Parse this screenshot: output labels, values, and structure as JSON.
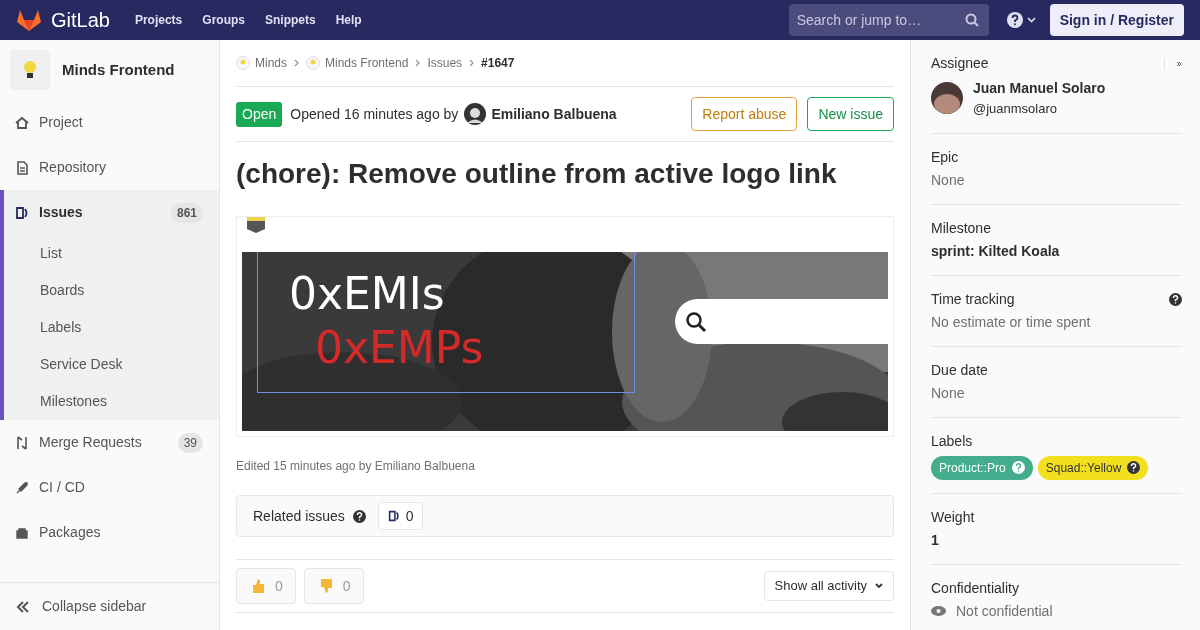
{
  "header": {
    "brand": "GitLab",
    "nav": [
      "Projects",
      "Groups",
      "Snippets",
      "Help"
    ],
    "search": {
      "placeholder": "Search or jump to…"
    },
    "signin": "Sign in / Register"
  },
  "sidebar": {
    "project": "Minds Frontend",
    "items": [
      {
        "label": "Project",
        "selected": false
      },
      {
        "label": "Repository",
        "selected": false
      },
      {
        "label": "Issues",
        "selected": true,
        "count": "861",
        "children": [
          {
            "label": "List"
          },
          {
            "label": "Boards"
          },
          {
            "label": "Labels"
          },
          {
            "label": "Service Desk"
          },
          {
            "label": "Milestones"
          }
        ]
      },
      {
        "label": "Merge Requests",
        "selected": false,
        "count": "39"
      },
      {
        "label": "CI / CD",
        "selected": false
      },
      {
        "label": "Packages",
        "selected": false
      }
    ],
    "collapse": "Collapse sidebar"
  },
  "breadcrumbs": [
    {
      "label": "Minds",
      "avatar": true
    },
    {
      "label": "Minds Frontend",
      "avatar": true
    },
    {
      "label": "Issues",
      "avatar": false
    },
    {
      "label": "#1647",
      "avatar": false
    }
  ],
  "issue": {
    "status": "Open",
    "opened": "Opened 16 minutes ago by",
    "author": "Emiliano Balbuena",
    "actions": [
      {
        "label": "Report abuse",
        "kind": "warning"
      },
      {
        "label": "New issue",
        "kind": "success"
      }
    ],
    "title": "(chore): Remove outline from active logo link",
    "attachment": {
      "kind": "picture",
      "text_white": "0xEMIs",
      "text_red": "0xEMPs"
    },
    "edited": "Edited 15 minutes ago by Emiliano Balbuena",
    "related": {
      "label": "Related issues",
      "count": "0"
    },
    "reactions": [
      {
        "kind": "up",
        "count": "0"
      },
      {
        "kind": "down",
        "count": "0"
      }
    ],
    "activity": "Show all activity"
  },
  "right": {
    "sections": [
      {
        "kind": "user",
        "title": "Assignee",
        "name": "Juan Manuel Solaro",
        "handle": "@juanmsolaro"
      },
      {
        "kind": "muted",
        "title": "Epic",
        "value": "None"
      },
      {
        "kind": "bold",
        "title": "Milestone",
        "value": "sprint: Kilted Koala"
      },
      {
        "kind": "muted",
        "title": "Time tracking",
        "value": "No estimate or time spent",
        "help": true
      },
      {
        "kind": "muted",
        "title": "Due date",
        "value": "None"
      },
      {
        "kind": "labels",
        "title": "Labels",
        "labels": [
          {
            "text": "Product::Pro",
            "color": "#44ad8e",
            "dark": false
          },
          {
            "text": "Squad::Yellow",
            "color": "#f2e01f",
            "dark": true
          }
        ]
      },
      {
        "kind": "bold",
        "title": "Weight",
        "value": "1"
      },
      {
        "kind": "eye",
        "title": "Confidentiality",
        "value": "Not confidential"
      }
    ]
  }
}
